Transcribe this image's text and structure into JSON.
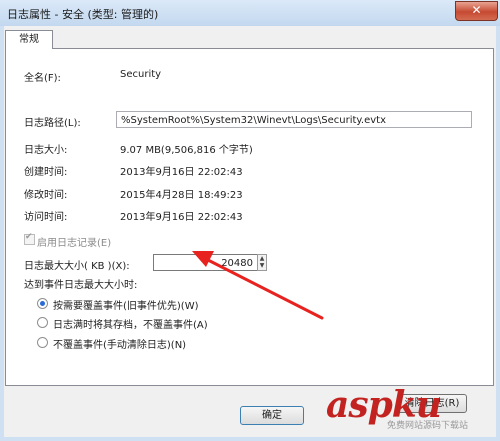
{
  "window": {
    "title": "日志属性 - 安全 (类型: 管理的)",
    "close_glyph": "✕"
  },
  "tabs": [
    {
      "label": "常规"
    }
  ],
  "fields": {
    "full_name_label": "全名(F):",
    "full_name_value": "Security",
    "path_label": "日志路径(L):",
    "path_value": "%SystemRoot%\\System32\\Winevt\\Logs\\Security.evtx",
    "size_label": "日志大小:",
    "size_value": "9.07 MB(9,506,816 个字节)",
    "created_label": "创建时间:",
    "created_value": "2013年9月16日 22:02:43",
    "modified_label": "修改时间:",
    "modified_value": "2015年4月28日 18:49:23",
    "accessed_label": "访问时间:",
    "accessed_value": "2013年9月16日 22:02:43"
  },
  "enable_logging": {
    "label": "启用日志记录(E)",
    "checked": true,
    "disabled": true
  },
  "max_size": {
    "label": "日志最大大小( KB )(X):",
    "value": "20480"
  },
  "policy": {
    "heading": "达到事件日志最大大小时:",
    "options": [
      {
        "label": "按需要覆盖事件(旧事件优先)(W)",
        "selected": true
      },
      {
        "label": "日志满时将其存档，不覆盖事件(A)",
        "selected": false
      },
      {
        "label": "不覆盖事件(手动清除日志)(N)",
        "selected": false
      }
    ]
  },
  "buttons": {
    "clear_log": "清除日志(R)",
    "ok": "确定"
  },
  "watermark": {
    "logo": "aspku",
    "sub": "免费网站源码下载站"
  },
  "colors": {
    "annotation_arrow": "#e8231f",
    "title_bg": "#cfe0f3",
    "radio_dot": "#2a6bd6"
  }
}
